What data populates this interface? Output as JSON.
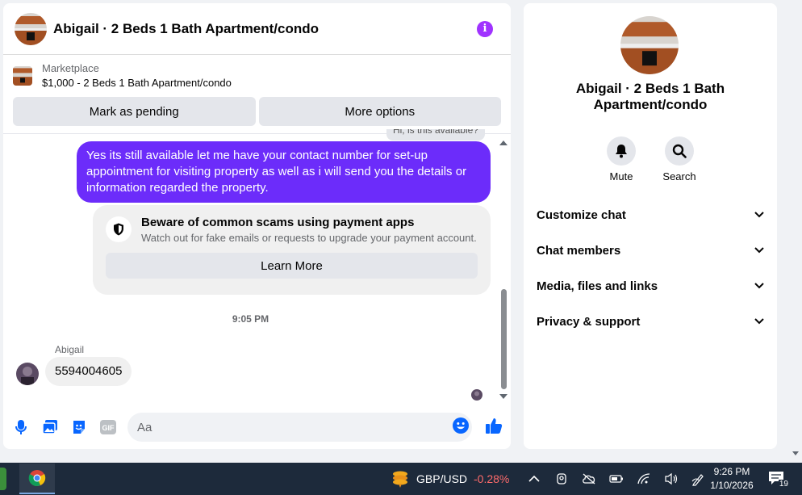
{
  "chat": {
    "title": "Abigail · 2 Beds 1 Bath Apartment/condo",
    "marketplace_label": "Marketplace",
    "listing": "$1,000 - 2 Beds 1 Bath Apartment/condo",
    "buttons": {
      "pending": "Mark as pending",
      "more": "More options"
    },
    "messages": {
      "hidden_preview": "Hi, is this available?",
      "outgoing": "Yes its still available let me have your contact number for set-up appointment for visiting property as well as i will send you the details or information regarded the property.",
      "warning_title": "Beware of common scams using payment apps",
      "warning_sub": "Watch out for fake emails or requests to upgrade your payment account.",
      "learn_more": "Learn More",
      "timestamp": "9:05 PM",
      "sender": "Abigail",
      "incoming": "5594004605"
    },
    "composer_placeholder": "Aa"
  },
  "side": {
    "title": "Abigail · 2 Beds 1 Bath Apartment/condo",
    "actions": {
      "mute": "Mute",
      "search": "Search"
    },
    "menu": [
      "Customize chat",
      "Chat members",
      "Media, files and links",
      "Privacy & support"
    ]
  },
  "taskbar": {
    "ticker_pair": "GBP/USD",
    "ticker_change": "-0.28%",
    "time": "9:26 PM",
    "date": "1/10/2026",
    "notifications": "19"
  },
  "colors": {
    "accent": "#a033ff",
    "outgoing_bubble": "#6c2cfa",
    "messenger_blue": "#0866ff"
  }
}
